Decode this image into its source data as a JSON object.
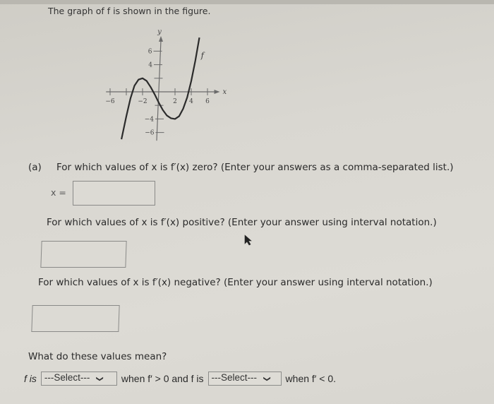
{
  "intro": "The graph of f is shown in the figure.",
  "graph": {
    "y_axis_label": "y",
    "x_axis_label": "x",
    "curve_label": "f",
    "x_tick_labels": [
      "−6",
      "−2",
      "2",
      "4",
      "6"
    ],
    "y_tick_labels": [
      "6",
      "4",
      "−4",
      "−6"
    ]
  },
  "chart_data": {
    "type": "line",
    "title": "",
    "xlabel": "x",
    "ylabel": "y",
    "xlim": [
      -6.5,
      7
    ],
    "ylim": [
      -7,
      8
    ],
    "x_ticks": [
      -6,
      -4,
      -2,
      2,
      4,
      6
    ],
    "x_tick_labels": [
      "−6",
      "",
      "−2",
      "2",
      "4",
      "6"
    ],
    "y_ticks": [
      -6,
      -4,
      -2,
      2,
      4,
      6
    ],
    "y_tick_labels": [
      "−6",
      "−4",
      "",
      "",
      "4",
      "6"
    ],
    "grid": false,
    "series": [
      {
        "name": "f",
        "points": [
          [
            -4.6,
            -7
          ],
          [
            -4.0,
            -3.6
          ],
          [
            -3.5,
            -1.0
          ],
          [
            -3.0,
            0.9
          ],
          [
            -2.5,
            1.8
          ],
          [
            -2.0,
            2.0
          ],
          [
            -1.5,
            1.6
          ],
          [
            -1.0,
            0.7
          ],
          [
            -0.5,
            -0.4
          ],
          [
            0.0,
            -1.6
          ],
          [
            0.5,
            -2.7
          ],
          [
            1.0,
            -3.5
          ],
          [
            1.5,
            -3.9
          ],
          [
            2.0,
            -4.0
          ],
          [
            2.5,
            -3.6
          ],
          [
            3.0,
            -2.5
          ],
          [
            3.5,
            -0.8
          ],
          [
            4.0,
            1.6
          ],
          [
            4.5,
            4.6
          ],
          [
            5.0,
            8.0
          ]
        ]
      }
    ]
  },
  "part_a": {
    "label": "(a)",
    "q_zero": "For which values of x is f′(x) zero? (Enter your answers as a comma-separated list.)",
    "x_equals": "x =",
    "answer_zero": "",
    "q_positive": "For which values of x is f′(x) positive? (Enter your answer using interval notation.)",
    "answer_positive": "",
    "q_negative": "For which values of x is f′(x) negative? (Enter your answer using interval notation.)",
    "answer_negative": "",
    "q_meaning": "What do these values mean?",
    "sentence": {
      "part1": "f is",
      "select1": "---Select---",
      "part2": "when f′ > 0 and f is",
      "select2": "---Select---",
      "part3": "when f′ < 0."
    }
  }
}
